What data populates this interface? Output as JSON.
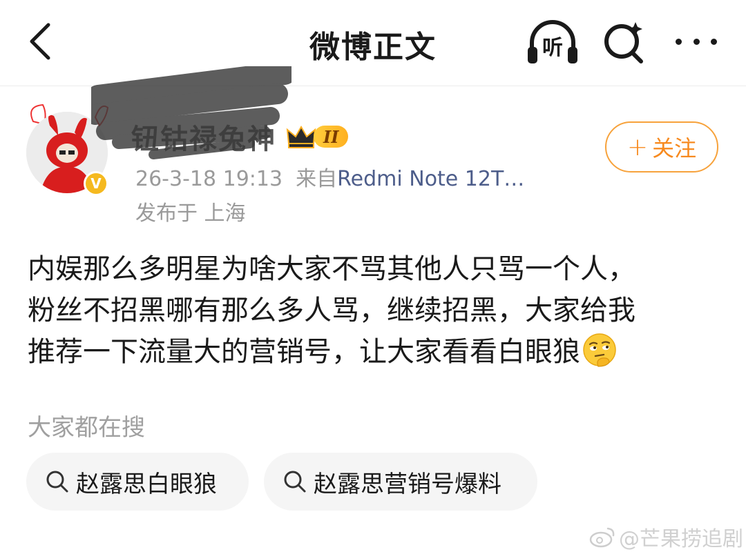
{
  "header": {
    "title": "微博正文",
    "listen_label": "听"
  },
  "author": {
    "username": "钮钴禄兔神",
    "level_badge": "II",
    "verified_badge": "V",
    "timestamp": "26-3-18 19:13",
    "source_prefix": "来自",
    "device": "Redmi Note 12T…",
    "location": "发布于 上海",
    "follow_label": "关注",
    "follow_plus": "+"
  },
  "post": {
    "lines": [
      "内娱那么多明星为啥大家不骂其他人只骂一个人，",
      "粉丝不招黑哪有那么多人骂，继续招黑，大家给我",
      "推荐一下流量大的营销号，让大家看看白眼狼"
    ],
    "emoji": "thinking-face-emoji"
  },
  "trending": {
    "label": "大家都在搜",
    "chips": [
      {
        "text": "赵露思白眼狼"
      },
      {
        "text": "赵露思营销号爆料"
      }
    ]
  },
  "watermark": "@芒果捞追剧",
  "colors": {
    "accent_orange": "#f78a1f",
    "device_link": "#4d5d8a",
    "meta_gray": "#9a9a9a",
    "chip_bg": "#f5f5f5"
  }
}
